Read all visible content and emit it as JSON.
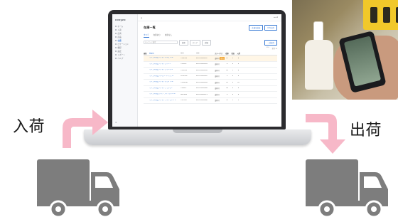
{
  "labels": {
    "inbound": "入荷",
    "outbound": "出荷"
  },
  "app": {
    "logo": "cosyzo",
    "menu_icon": "hamburger-icon",
    "title": "在庫一覧",
    "buttons": [
      "在庫を追加",
      "CSV出力"
    ],
    "tabs": [
      "すべて",
      "在庫あり",
      "在庫なし"
    ],
    "filter_placeholder": "キーワード検索",
    "filter_buttons": [
      "検索",
      "クリア",
      "詳細"
    ],
    "right_button": "一括操作",
    "pager": [
      "1-10",
      "全件 10"
    ],
    "columns": [
      "画像",
      "商品名",
      "SKU",
      "JAN",
      "ステータス",
      "在庫",
      "引当",
      "入荷"
    ]
  },
  "sidebar": {
    "items": [
      {
        "label": "ホーム"
      },
      {
        "label": "入荷"
      },
      {
        "label": "出荷"
      },
      {
        "label": "商品"
      },
      {
        "label": "在庫"
      },
      {
        "label": "ロケーション"
      },
      {
        "label": "棚卸"
      },
      {
        "label": "設定"
      },
      {
        "label": "レポート"
      },
      {
        "label": "ヘルプ"
      }
    ]
  },
  "rows": [
    {
      "color": "#2d3e5c",
      "name": "サンプル商品 Tシャツ ネイビー M",
      "sku": "TS-NV-M",
      "jan": "4901234500011",
      "status": "出荷可",
      "badge": "引当",
      "qty": "12",
      "alloc": "2",
      "inbound": "0",
      "highlight": true
    },
    {
      "color": "#7a7d85",
      "name": "サンプル商品 Tシャツ グレー L",
      "sku": "TS-GR-L",
      "jan": "4901234500028",
      "status": "出荷可",
      "badge": "",
      "qty": "8",
      "alloc": "0",
      "inbound": "5",
      "highlight": false
    },
    {
      "color": "#9bbf5a",
      "name": "サンプル商品 Tシャツ グリーン S",
      "sku": "TS-GN-S",
      "jan": "4901234500035",
      "status": "出荷可",
      "badge": "",
      "qty": "20",
      "alloc": "1",
      "inbound": "0",
      "highlight": false
    },
    {
      "color": "#d9c48a",
      "name": "サンプル商品 パーカー ベージュ M",
      "sku": "PK-BG-M",
      "jan": "4901234500042",
      "status": "出荷可",
      "badge": "",
      "qty": "5",
      "alloc": "0",
      "inbound": "0",
      "highlight": false
    },
    {
      "color": "#e8e8e8",
      "name": "サンプル商品 Tシャツ ホワイト M",
      "sku": "TS-WH-M",
      "jan": "4901234500059",
      "status": "出荷可",
      "badge": "",
      "qty": "15",
      "alloc": "3",
      "inbound": "10",
      "highlight": false
    },
    {
      "color": "#2b2b2b",
      "name": "サンプル商品 Tシャツ ブラック L",
      "sku": "TS-BK-L",
      "jan": "4901234500066",
      "status": "出荷可",
      "badge": "",
      "qty": "30",
      "alloc": "4",
      "inbound": "0",
      "highlight": false
    },
    {
      "color": "#c7d2e2",
      "name": "サンプル商品 シャツ ライトブルー M",
      "sku": "SH-LB-M",
      "jan": "4901234500073",
      "status": "出荷可",
      "badge": "",
      "qty": "9",
      "alloc": "0",
      "inbound": "0",
      "highlight": false
    },
    {
      "color": "#d5d5d5",
      "name": "サンプル商品 Tシャツ ライトグレー S",
      "sku": "TS-LG-S",
      "jan": "4901234500080",
      "status": "出荷可",
      "badge": "",
      "qty": "11",
      "alloc": "1",
      "inbound": "2",
      "highlight": false
    }
  ],
  "colors": {
    "arrow": "#f7b8c8",
    "truck": "#7d7d7d",
    "accent": "#3a7bd5"
  }
}
